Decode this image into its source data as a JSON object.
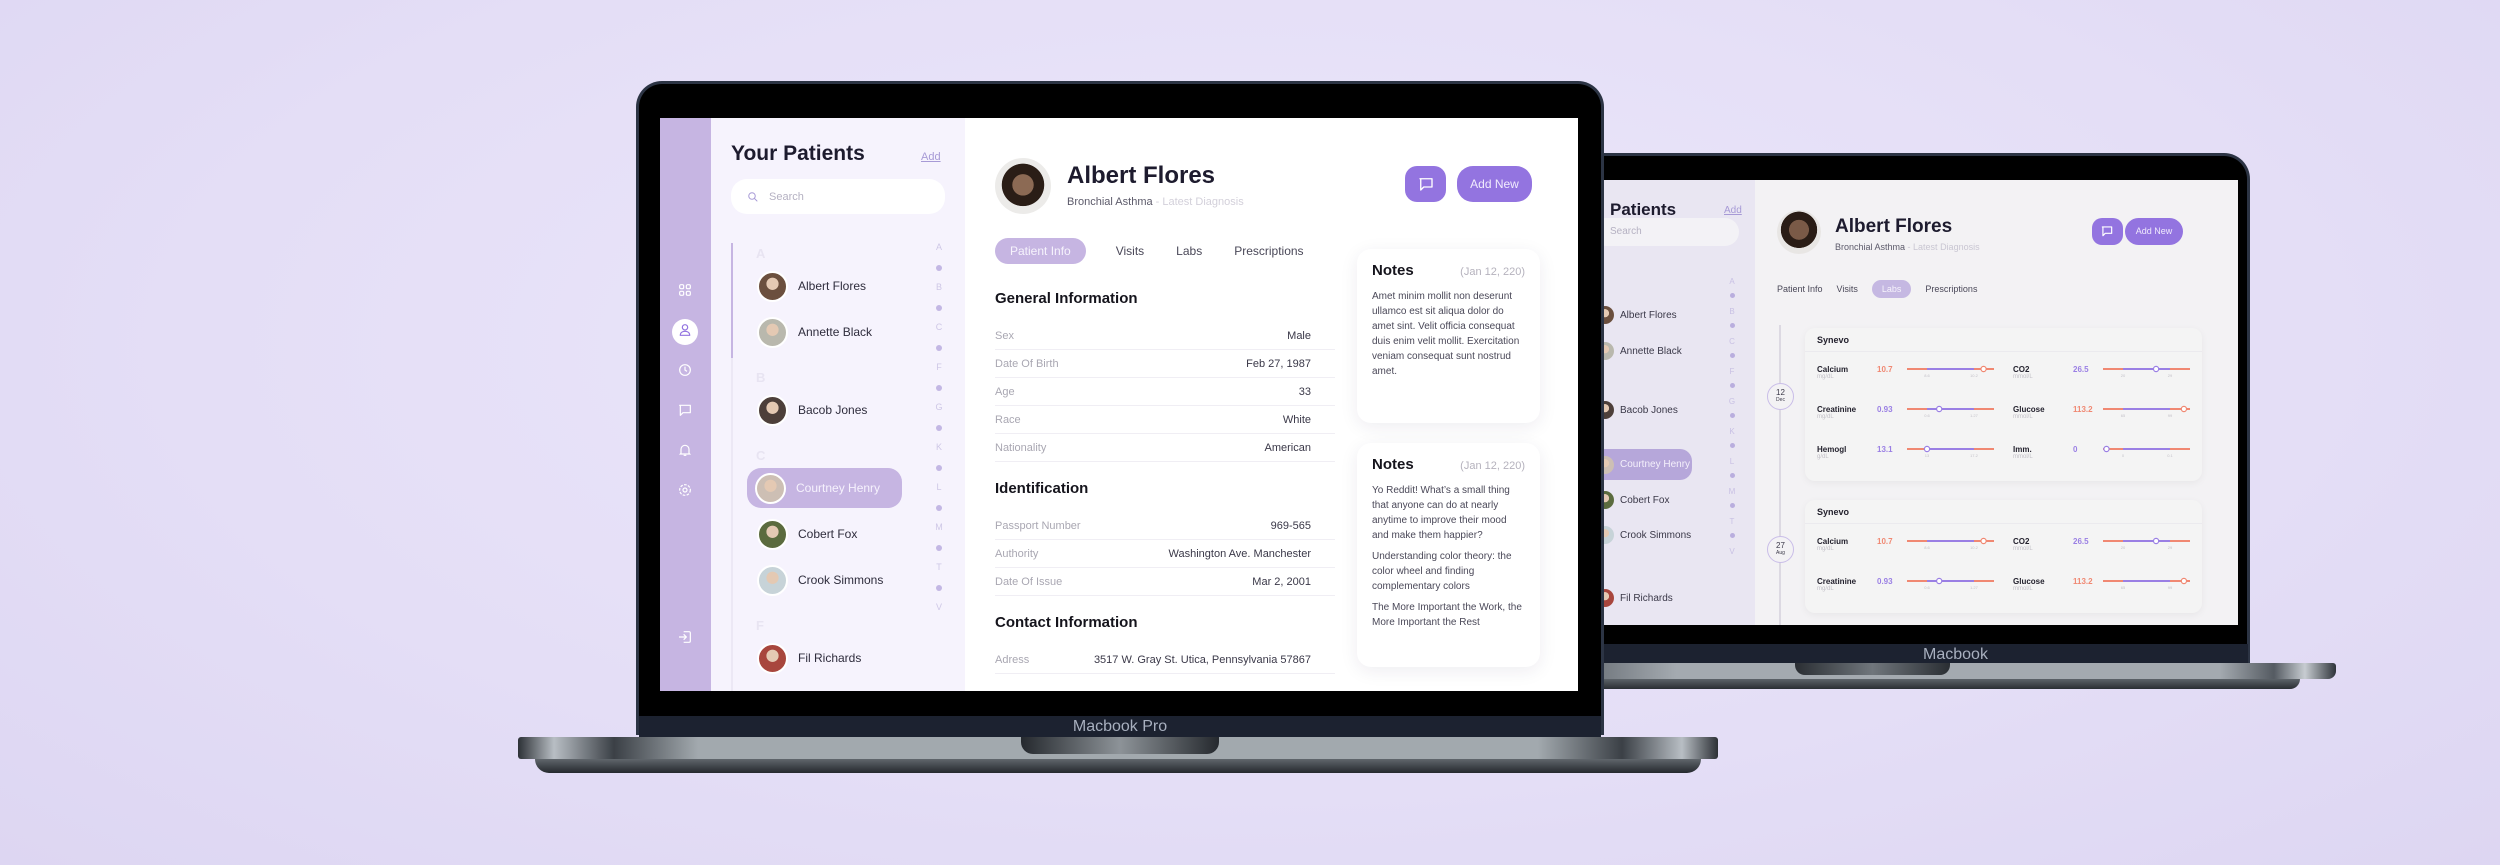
{
  "front_device": {
    "label": "Macbook Pro",
    "sidebar_icons": [
      {
        "name": "dashboard-icon",
        "active": false
      },
      {
        "name": "user-icon",
        "active": true
      },
      {
        "name": "clock-icon",
        "active": false
      },
      {
        "name": "chat-icon",
        "active": false
      },
      {
        "name": "bell-icon",
        "active": false
      },
      {
        "name": "gear-icon",
        "active": false
      },
      {
        "name": "logout-icon",
        "active": false
      }
    ],
    "patients_panel": {
      "title": "Your Patients",
      "add_label": "Add",
      "search_placeholder": "Search",
      "groups": [
        {
          "letter": "A",
          "patients": [
            "Albert Flores",
            "Annette Black"
          ]
        },
        {
          "letter": "B",
          "patients": [
            "Bacob Jones"
          ]
        },
        {
          "letter": "C",
          "patients": [
            "Courtney Henry",
            "Cobert Fox",
            "Crook Simmons"
          ]
        },
        {
          "letter": "F",
          "patients": [
            "Fil Richards"
          ]
        }
      ],
      "selected_patient": "Courtney Henry",
      "alphabet_index": [
        "A",
        "B",
        "C",
        "F",
        "G",
        "K",
        "L",
        "M",
        "T",
        "V"
      ]
    },
    "patient": {
      "name": "Albert Flores",
      "diagnosis": "Bronchial Asthma",
      "diagnosis_suffix": " - Latest Diagnosis",
      "add_new_label": "Add New",
      "tabs": [
        "Patient Info",
        "Visits",
        "Labs",
        "Prescriptions"
      ],
      "active_tab": "Patient Info",
      "sections": [
        {
          "title": "General Information",
          "rows": [
            {
              "label": "Sex",
              "value": "Male"
            },
            {
              "label": "Date Of Birth",
              "value": "Feb 27, 1987"
            },
            {
              "label": "Age",
              "value": "33"
            },
            {
              "label": "Race",
              "value": "White"
            },
            {
              "label": "Nationality",
              "value": "American"
            }
          ]
        },
        {
          "title": "Identification",
          "rows": [
            {
              "label": "Passport Number",
              "value": "969-565"
            },
            {
              "label": "Authority",
              "value": "Washington Ave. Manchester"
            },
            {
              "label": "Date Of Issue",
              "value": "Mar 2, 2001"
            }
          ]
        },
        {
          "title": "Contact Information",
          "rows": [
            {
              "label": "Adress",
              "value": "3517 W. Gray St. Utica, Pennsylvania 57867"
            }
          ]
        }
      ]
    },
    "notes": [
      {
        "title": "Notes",
        "date": "(Jan 12, 220)",
        "paragraphs": [
          "Amet minim mollit non deserunt ullamco est sit aliqua dolor do amet sint. Velit officia consequat duis enim velit mollit. Exercitation veniam consequat sunt nostrud amet."
        ]
      },
      {
        "title": "Notes",
        "date": "(Jan 12, 220)",
        "paragraphs": [
          "Yo Reddit! What’s a small thing that anyone can do at nearly anytime to improve their mood and make them happier?",
          "Understanding color theory: the color wheel and finding complementary colors",
          "The More Important the Work, the More Important the Rest"
        ]
      }
    ]
  },
  "back_device": {
    "label": "Macbook",
    "patients_panel": {
      "title": "Patients",
      "add_label": "Add",
      "search_placeholder": "Search",
      "patients": [
        "Albert Flores",
        "Annette Black",
        "Bacob Jones",
        "Courtney Henry",
        "Cobert Fox",
        "Crook Simmons",
        "Fil Richards"
      ],
      "selected_patient": "Courtney Henry",
      "alphabet_index": [
        "A",
        "B",
        "C",
        "F",
        "G",
        "K",
        "L",
        "M",
        "T",
        "V"
      ]
    },
    "patient": {
      "name": "Albert Flores",
      "diagnosis": "Bronchial Asthma",
      "diagnosis_suffix": " - Latest Diagnosis",
      "add_new_label": "Add New",
      "tabs": [
        "Patient Info",
        "Visits",
        "Labs",
        "Prescriptions"
      ],
      "active_tab": "Labs"
    },
    "lab_results": [
      {
        "day": "12",
        "month": "Dec",
        "lab": "Synevo",
        "tests": [
          {
            "name": "Calcium",
            "unit": "mg/dL",
            "value": "10.7",
            "status": "out",
            "range": [
              "8.6",
              "10.2"
            ],
            "position": 0.88
          },
          {
            "name": "CO2",
            "unit": "mmol/L",
            "value": "26.5",
            "status": "in",
            "range": [
              "20",
              "29"
            ],
            "position": 0.61
          },
          {
            "name": "Creatinine",
            "unit": "mg/dL",
            "value": "0.93",
            "status": "in",
            "range": [
              "0.6",
              "1.27"
            ],
            "position": 0.37
          },
          {
            "name": "Glucose",
            "unit": "mmol/L",
            "value": "113.2",
            "status": "out",
            "range": [
              "65",
              "99"
            ],
            "position": 0.93
          },
          {
            "name": "Hemogl",
            "unit": "g/dL",
            "value": "13.1",
            "status": "in",
            "range": [
              "13",
              "17.2"
            ],
            "position": 0.23
          },
          {
            "name": "Imm.",
            "unit": "mmol/L",
            "value": "0",
            "status": "in",
            "range": [
              "0",
              "0.1"
            ],
            "position": 0.04
          }
        ]
      },
      {
        "day": "27",
        "month": "Aug",
        "lab": "Synevo",
        "tests": [
          {
            "name": "Calcium",
            "unit": "mg/dL",
            "value": "10.7",
            "status": "out",
            "range": [
              "8.6",
              "10.2"
            ],
            "position": 0.88
          },
          {
            "name": "CO2",
            "unit": "mmol/L",
            "value": "26.5",
            "status": "in",
            "range": [
              "20",
              "29"
            ],
            "position": 0.61
          },
          {
            "name": "Creatinine",
            "unit": "mg/dL",
            "value": "0.93",
            "status": "in",
            "range": [
              "0.6",
              "1.27"
            ],
            "position": 0.37
          },
          {
            "name": "Glucose",
            "unit": "mmol/L",
            "value": "113.2",
            "status": "out",
            "range": [
              "65",
              "99"
            ],
            "position": 0.93
          }
        ]
      }
    ]
  },
  "colors": {
    "accent": "#9374e0",
    "accent_soft": "#c6b5e2",
    "in_range": "#9a7fe4",
    "out_of_range": "#f08872"
  }
}
